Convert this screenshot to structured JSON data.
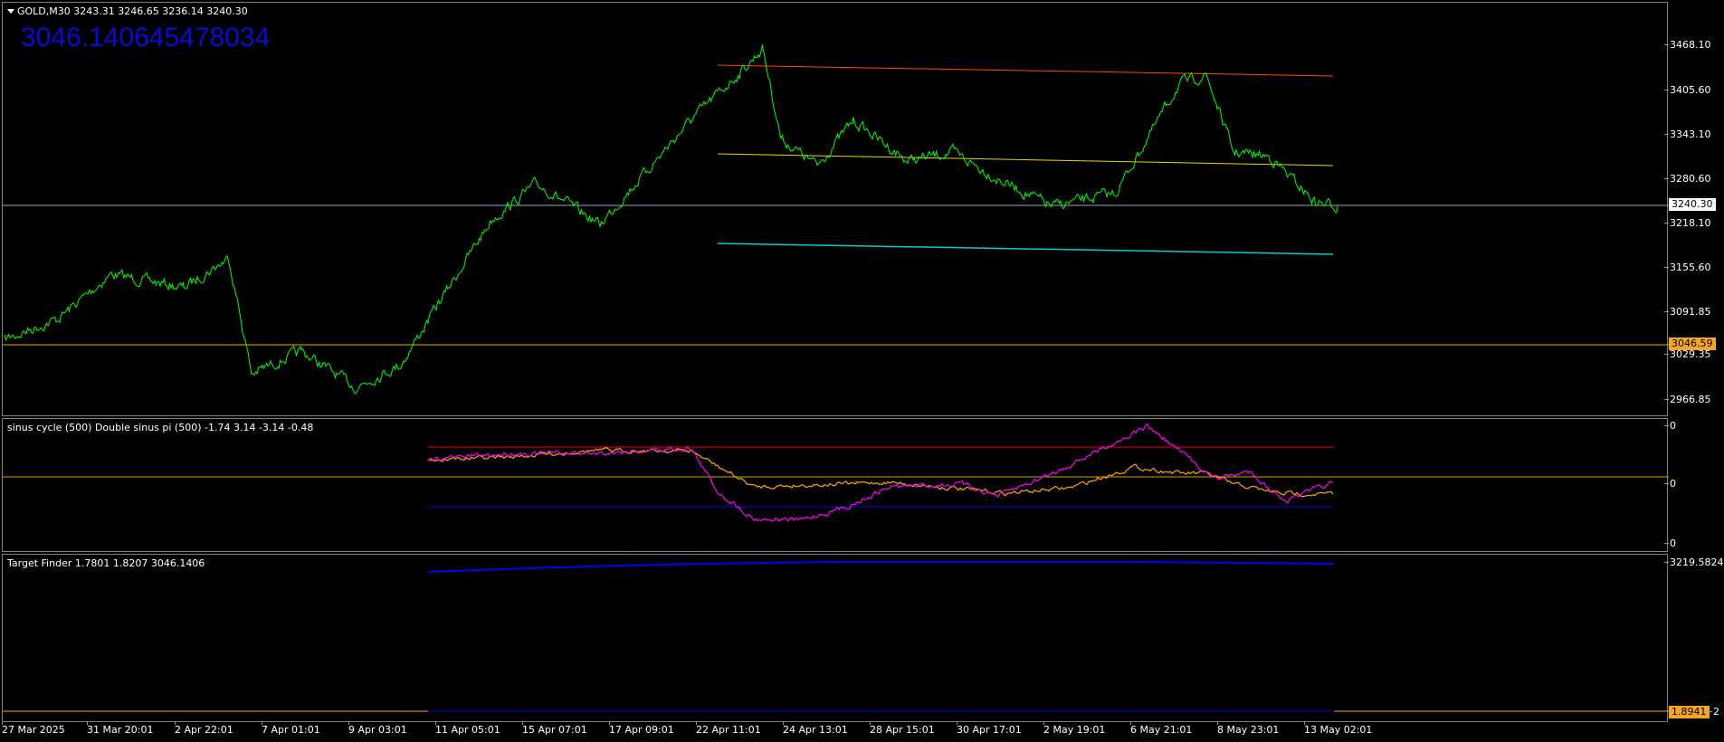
{
  "main_chart": {
    "symbol_line": "GOLD,M30  3243.31 3246.65 3236.14 3240.30",
    "big_value": "3046.140645478034",
    "y_ticks": [
      "3468.10",
      "3405.60",
      "3343.10",
      "3280.60",
      "3218.10",
      "3155.60",
      "3091.85",
      "3029.35",
      "2966.85"
    ],
    "bid_price": "3240.30",
    "level_price": "3046.59",
    "colors": {
      "price": "#00ff00",
      "channel_top": "#ff4b00",
      "channel_mid": "#f0d000",
      "channel_bottom": "#00d0d0",
      "bid_line": "#8fa8c8",
      "level_line": "#f5a623"
    }
  },
  "sinus_pane": {
    "title": "sinus cycle (500)  Double sinus pi (500) -1.74 3.14 -3.14 -0.48",
    "y_ticks": [
      "0",
      "0",
      "0"
    ],
    "colors": {
      "magenta": "#ff00ff",
      "orange": "#ffa500",
      "top_line": "#ff0000",
      "mid_line": "#c8a400",
      "bottom_line": "#0000ff"
    }
  },
  "target_pane": {
    "title": "Target Finder 1.7801 1.8207 3046.1406",
    "y_top": "3219.5824",
    "y_bottom": "1.8941",
    "y_bottom_suffix": "2",
    "colors": {
      "curve": "#0000ff",
      "level": "#f5a623"
    }
  },
  "x_axis": {
    "labels": [
      "27 Mar 2025",
      "31 Mar 20:01",
      "2 Apr 22:01",
      "7 Apr 01:01",
      "9 Apr 03:01",
      "11 Apr 05:01",
      "15 Apr 07:01",
      "17 Apr 09:01",
      "22 Apr 11:01",
      "24 Apr 13:01",
      "28 Apr 15:01",
      "30 Apr 17:01",
      "2 May 19:01",
      "6 May 21:01",
      "8 May 23:01",
      "13 May 02:01"
    ]
  }
}
